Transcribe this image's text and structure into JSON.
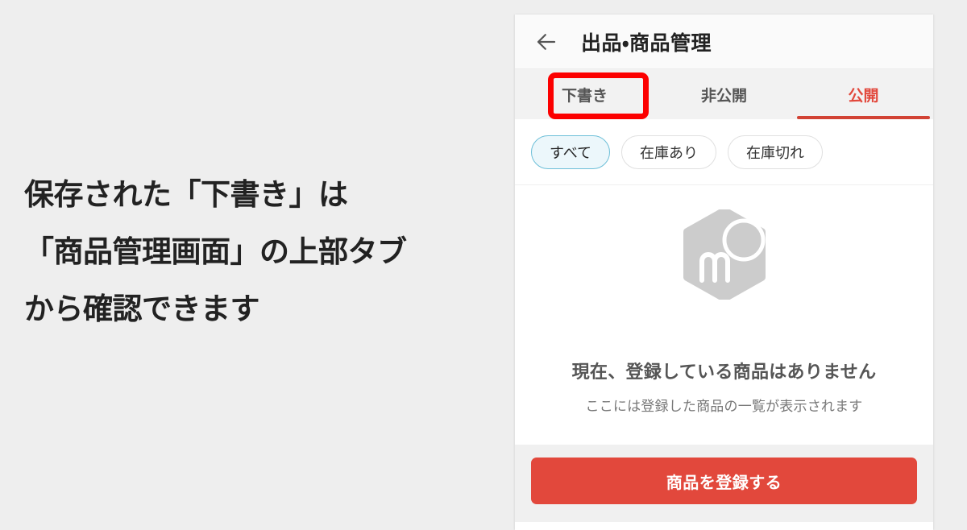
{
  "caption": {
    "lines": [
      "保存された「下書き」は",
      "「商品管理画面」の上部タブ",
      "から確認できます"
    ]
  },
  "phone": {
    "header": {
      "back_icon": "back-arrow-icon",
      "title": "出品・商品管理"
    },
    "tabs": [
      {
        "label": "下書き",
        "active": false,
        "highlighted": true
      },
      {
        "label": "非公開",
        "active": false,
        "highlighted": false
      },
      {
        "label": "公開",
        "active": true,
        "highlighted": false
      }
    ],
    "filters": [
      {
        "label": "すべて",
        "selected": true
      },
      {
        "label": "在庫あり",
        "selected": false
      },
      {
        "label": "在庫切れ",
        "selected": false
      }
    ],
    "empty_state": {
      "logo_icon": "mercari-hexagon-logo-icon",
      "title": "現在、登録している商品はありません",
      "subtitle": "ここには登録した商品の一覧が表示されます"
    },
    "cta": {
      "label": "商品を登録する"
    }
  },
  "colors": {
    "page_background": "#eeeeee",
    "brand_red": "#e2483c",
    "annotation_red": "#fc0000",
    "chip_selected_bg": "#ecf7fb",
    "chip_selected_border": "#6dbfd8",
    "tab_bar_bg": "#f2f2f2",
    "logo_grey": "#cccccc"
  }
}
